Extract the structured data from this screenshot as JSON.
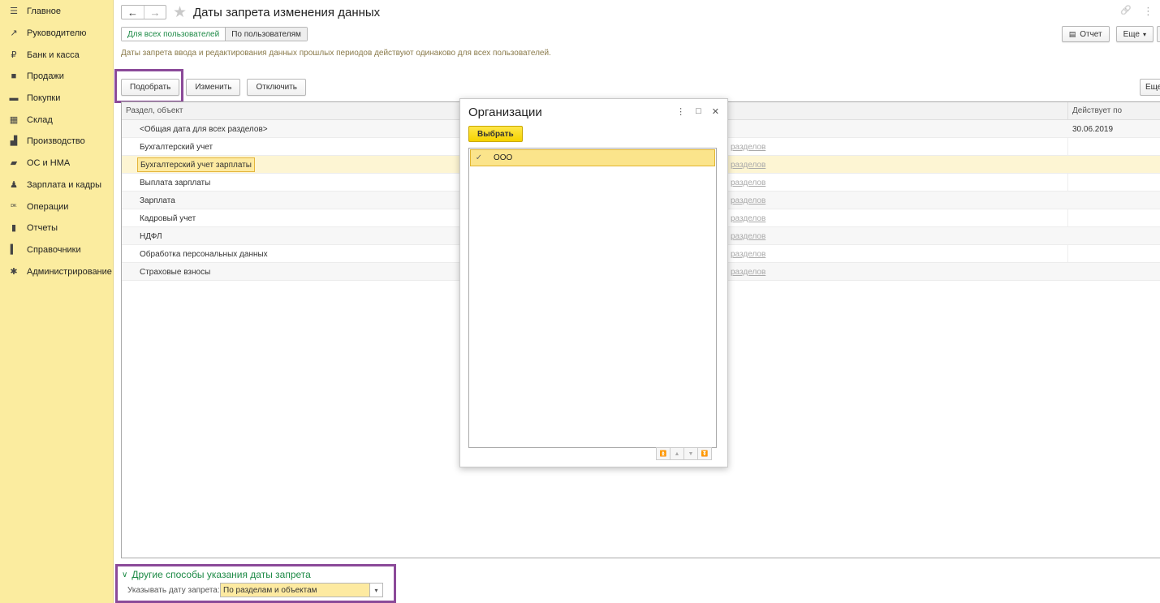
{
  "sidebar": {
    "items": [
      {
        "icon": "menu-icon",
        "glyph": "☰",
        "label": "Главное"
      },
      {
        "icon": "trend-icon",
        "glyph": "↗",
        "label": "Руководителю"
      },
      {
        "icon": "bank-icon",
        "glyph": "₽",
        "label": "Банк и касса"
      },
      {
        "icon": "bag-icon",
        "glyph": "■",
        "label": "Продажи"
      },
      {
        "icon": "cart-icon",
        "glyph": "▬",
        "label": "Покупки"
      },
      {
        "icon": "warehouse-icon",
        "glyph": "▦",
        "label": "Склад"
      },
      {
        "icon": "factory-icon",
        "glyph": "▟",
        "label": "Производство"
      },
      {
        "icon": "truck-icon",
        "glyph": "▰",
        "label": "ОС и НМА"
      },
      {
        "icon": "person-icon",
        "glyph": "♟",
        "label": "Зарплата и кадры"
      },
      {
        "icon": "ledger-icon",
        "glyph": "ᴰᴷ",
        "label": "Операции"
      },
      {
        "icon": "bar-chart-icon",
        "glyph": "▮",
        "label": "Отчеты"
      },
      {
        "icon": "book-icon",
        "glyph": "▍",
        "label": "Справочники"
      },
      {
        "icon": "gear-icon",
        "glyph": "✱",
        "label": "Администрирование"
      }
    ]
  },
  "header": {
    "title": "Даты запрета изменения данных",
    "back_glyph": "←",
    "forward_glyph": "→",
    "star_glyph": "★",
    "link_glyph": "🔗",
    "more_glyph": "⋮"
  },
  "tabs": {
    "all_users": "Для всех пользователей",
    "by_users": "По пользователям"
  },
  "toolbar_right": {
    "report_label": "Отчет",
    "report_glyph": "▤",
    "more_label": "Еще",
    "more_arrow": "▾"
  },
  "info_text": "Даты запрета ввода и редактирования данных прошлых периодов действуют одинаково для всех пользователей.",
  "commands": {
    "pick": "Подобрать",
    "change": "Изменить",
    "disable": "Отключить",
    "more_short": "Еще"
  },
  "table": {
    "col_section": "Раздел, объект",
    "col_date": "Действует по",
    "rows": [
      {
        "name": "<Общая дата для всех разделов>",
        "link": "",
        "date": "30.06.2019"
      },
      {
        "name": "Бухгалтерский учет",
        "link": "разделов",
        "date": ""
      },
      {
        "name": "Бухгалтерский учет зарплаты",
        "link": "разделов",
        "date": ""
      },
      {
        "name": "Выплата зарплаты",
        "link": "разделов",
        "date": ""
      },
      {
        "name": "Зарплата",
        "link": "разделов",
        "date": ""
      },
      {
        "name": "Кадровый учет",
        "link": "разделов",
        "date": ""
      },
      {
        "name": "НДФЛ",
        "link": "разделов",
        "date": ""
      },
      {
        "name": "Обработка персональных данных",
        "link": "разделов",
        "date": ""
      },
      {
        "name": "Страховые взносы",
        "link": "разделов",
        "date": ""
      }
    ]
  },
  "other_ways": {
    "title": "Другие способы указания даты запрета",
    "chevron": "∨",
    "mode_label": "Указывать дату запрета:",
    "mode_value": "По разделам и объектам",
    "dropdown_glyph": "▾"
  },
  "modal": {
    "title": "Организации",
    "select_label": "Выбрать",
    "menu_glyph": "⋮",
    "maximize_glyph": "□",
    "close_glyph": "✕",
    "items": [
      {
        "check": "✓",
        "name": "ООО"
      }
    ],
    "scroll": [
      "⏫",
      "▲",
      "▼",
      "⏬"
    ]
  },
  "colors": {
    "sidebar_bg": "#fbec9f",
    "accent_green": "#1d8a46",
    "highlight_purple": "#8b4a99",
    "primary_yellow": "#f5d200"
  }
}
